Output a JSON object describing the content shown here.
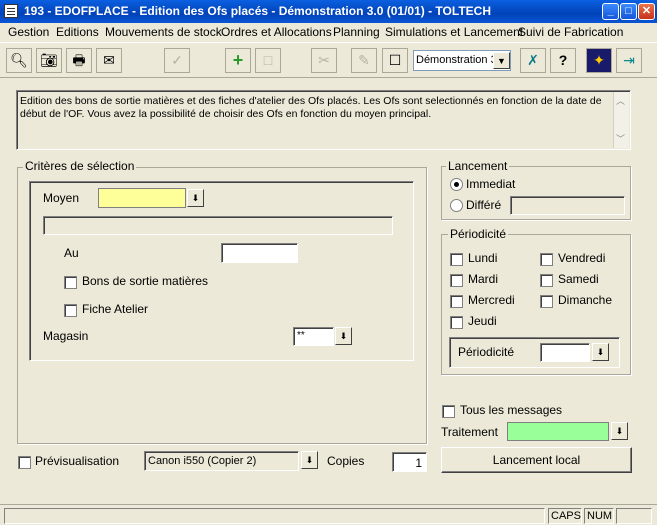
{
  "window": {
    "title": "193 - EDOFPLACE - Edition des Ofs placés - Démonstration 3.0 (01/01) - TOLTECH"
  },
  "menu": {
    "items": [
      "Gestion",
      "Editions",
      "Mouvements de stock",
      "Ordres et Allocations",
      "Planning",
      "Simulations et Lancement",
      "Suivi de Fabrication"
    ]
  },
  "toolbar": {
    "company_select": "Démonstration 3"
  },
  "description": {
    "text": "Edition des bons de sortie matières et des fiches d'atelier des Ofs placés. Les Ofs sont selectionnés en fonction de la date de début de l'OF. Vous avez la possibilité de choisir des Ofs en fonction du moyen principal."
  },
  "criteria": {
    "group_label": "Critères de sélection",
    "moyen_label": "Moyen",
    "moyen_value": "",
    "au_label": "Au",
    "au_value": "",
    "bons_label": "Bons de sortie matières",
    "fiche_label": "Fiche Atelier",
    "magasin_label": "Magasin",
    "magasin_value": "**"
  },
  "lancement": {
    "group_label": "Lancement",
    "immediat_label": "Immediat",
    "differe_label": "Différé",
    "differe_value": ""
  },
  "periodicite": {
    "group_label": "Périodicité",
    "days": {
      "lundi": "Lundi",
      "mardi": "Mardi",
      "mercredi": "Mercredi",
      "jeudi": "Jeudi",
      "vendredi": "Vendredi",
      "samedi": "Samedi",
      "dimanche": "Dimanche"
    },
    "periodicite_label": "Périodicité",
    "periodicite_value": ""
  },
  "messages": {
    "tous_label": "Tous les messages",
    "traitement_label": "Traitement",
    "traitement_value": ""
  },
  "bottom": {
    "preview_label": "Prévisualisation",
    "printer_value": "Canon i550 (Copier 2)",
    "copies_label": "Copies",
    "copies_value": "1",
    "launch_button": "Lancement local"
  },
  "status": {
    "caps": "CAPS",
    "num": "NUM"
  },
  "colors": {
    "titlebar": "#0a5fe0",
    "moyen_field": "#ffff99",
    "traitement_field": "#99ff99",
    "window_bg": "#ece9d8"
  }
}
